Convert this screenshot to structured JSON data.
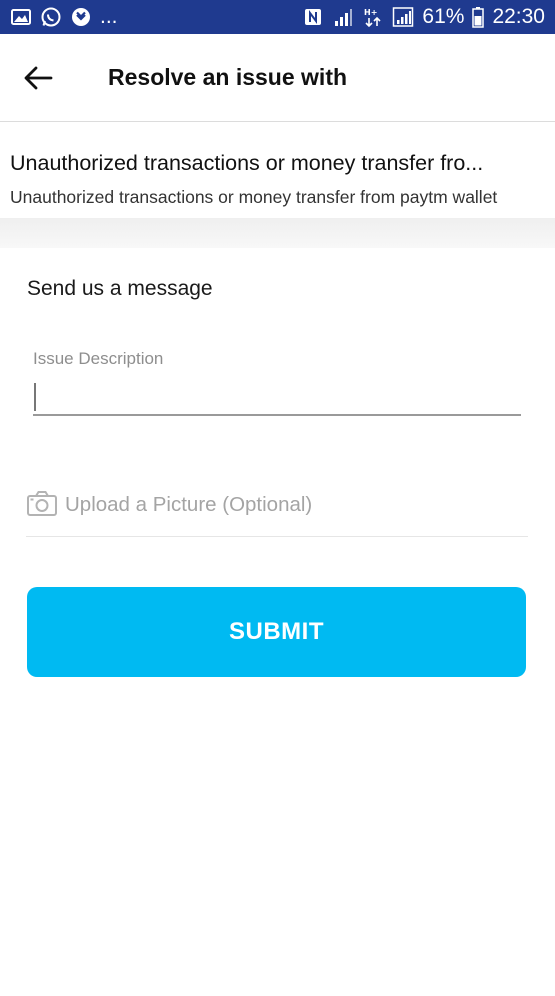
{
  "status_bar": {
    "notification_icons": [
      "gallery-icon",
      "whatsapp-icon",
      "shield-icon"
    ],
    "more": "...",
    "battery": "61%",
    "time": "22:30",
    "network_badge": "H+"
  },
  "header": {
    "back_icon": "arrow-left-icon",
    "title": "Resolve an issue with"
  },
  "issue": {
    "title": "Unauthorized transactions or money transfer fro...",
    "subtitle": "Unauthorized transactions or money transfer from paytm wallet"
  },
  "form": {
    "section_title": "Send us a message",
    "description_label": "Issue Description",
    "description_value": "",
    "upload_label": "Upload a Picture (Optional)",
    "submit_label": "SUBMIT"
  },
  "colors": {
    "status_bar": "#1f3a8f",
    "accent": "#00baf2"
  }
}
